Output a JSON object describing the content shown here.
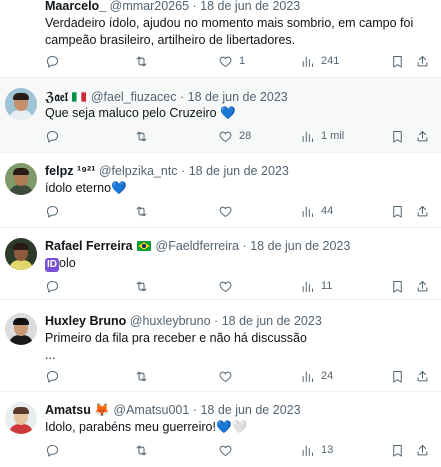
{
  "tweets": [
    {
      "name": "Maarcelo_",
      "handle": "@mmar20265",
      "dot": "·",
      "date": "18 de jun de 2023",
      "text": "Verdadeiro ídolo, ajudou no momento mais sombrio, em campo foi campeão brasileiro, artilheiro de libertadores.",
      "replies": "",
      "retweets": "",
      "likes": "1",
      "views": "241"
    },
    {
      "name": "ℨ𝔞𝔢𝔩",
      "name_suffix": "🇮🇹",
      "handle": "@fael_fiuzacec",
      "dot": "·",
      "date": "18 de jun de 2023",
      "text": "Que seja maluco pelo Cruzeiro",
      "text_emoji": "💙",
      "replies": "",
      "retweets": "",
      "likes": "28",
      "views": "1 mil"
    },
    {
      "name": "felpz ¹⁹²¹",
      "handle": "@felpzika_ntc",
      "dot": "·",
      "date": "18 de jun de 2023",
      "text": "ídolo eterno",
      "text_emoji": "💙",
      "replies": "",
      "retweets": "",
      "likes": "",
      "views": "44"
    },
    {
      "name": "Rafael Ferreira",
      "name_suffix": "🇧🇷",
      "handle": "@Faeldferreira",
      "dot": "·",
      "date": "18 de jun de 2023",
      "text_badge": "ID",
      "text": "olo",
      "replies": "",
      "retweets": "",
      "likes": "",
      "views": "11"
    },
    {
      "name": "Huxley Bruno",
      "handle": "@huxleybruno",
      "dot": "·",
      "date": "18 de jun de 2023",
      "text": "Primeiro da fila pra receber e não há discussão",
      "text2": "...",
      "replies": "",
      "retweets": "",
      "likes": "",
      "views": "24"
    },
    {
      "name": "Amatsu",
      "name_suffix": "🦊",
      "handle": "@Amatsu001",
      "dot": "·",
      "date": "18 de jun de 2023",
      "text": "Idolo, parabéns meu guerreiro!",
      "text_emoji": "💙🤍",
      "replies": "",
      "retweets": "",
      "likes": "",
      "views": "13"
    }
  ],
  "icons": {
    "reply": "reply-icon",
    "retweet": "retweet-icon",
    "like": "heart-icon",
    "views": "views-icon",
    "bookmark": "bookmark-icon",
    "share": "share-icon"
  },
  "colors": {
    "text": "#0f1419",
    "secondary": "#536471",
    "divider": "#eff3f4",
    "blue_heart": "#5b9bd5"
  }
}
